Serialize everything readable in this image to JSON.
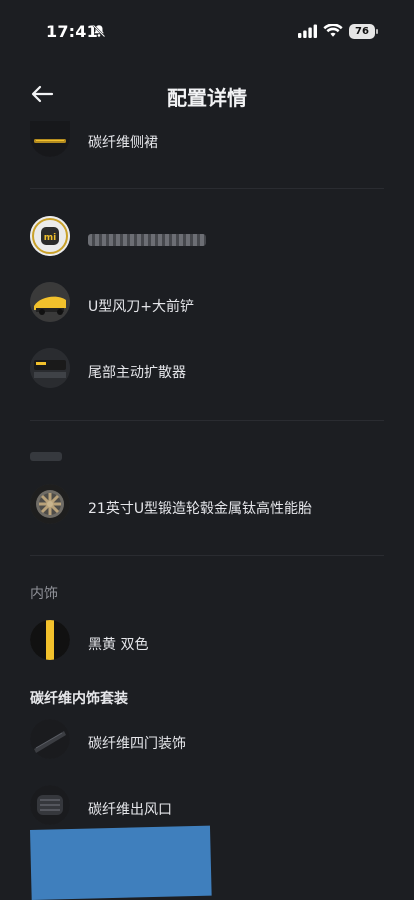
{
  "status": {
    "time": "17:41",
    "battery": "76"
  },
  "header": {
    "title": "配置详情"
  },
  "items": {
    "side_skirt": "碳纤维侧裙",
    "blurred_text": "",
    "spoiler": "U型风刀+大前铲",
    "diffuser": "尾部主动扩散器",
    "wheels": "21英寸U型锻造轮毂金属钛高性能胎",
    "interior_color": "黑黄 双色",
    "trim_4door": "碳纤维四门装饰",
    "vent": "碳纤维出风口"
  },
  "sections": {
    "interior": "内饰",
    "carbon_pack": "碳纤维内饰套装"
  },
  "colors": {
    "background": "#1c1e22",
    "accent_yellow": "#f2c12c",
    "redaction_blue": "#3f7fbd"
  }
}
